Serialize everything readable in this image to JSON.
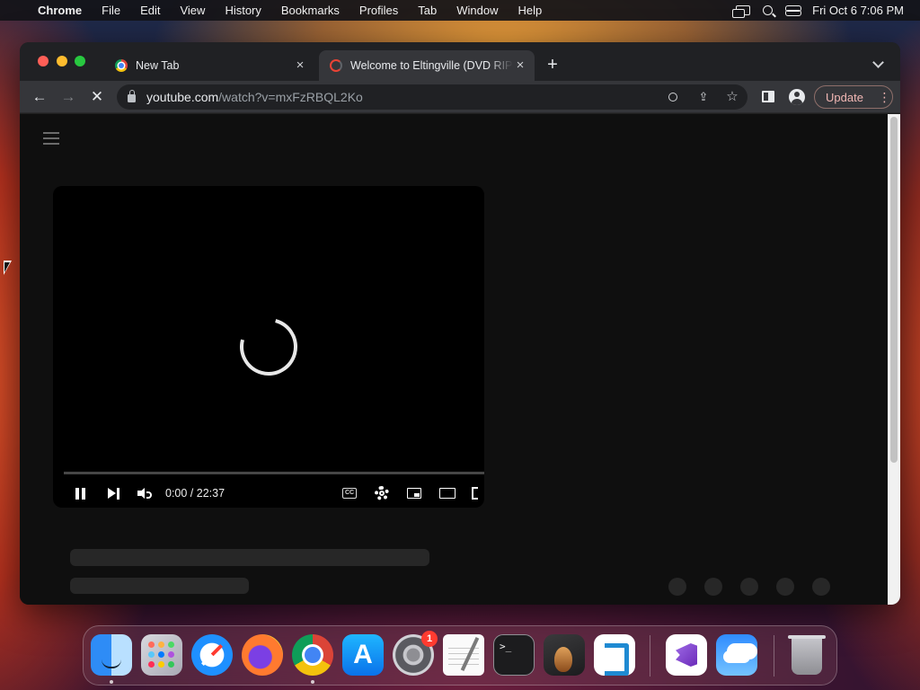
{
  "menubar": {
    "app": "Chrome",
    "items": [
      "File",
      "Edit",
      "View",
      "History",
      "Bookmarks",
      "Profiles",
      "Tab",
      "Window",
      "Help"
    ],
    "clock": "Fri Oct 6  7:06 PM"
  },
  "browser": {
    "tabs": [
      {
        "title": "New Tab",
        "close": "×"
      },
      {
        "title": "Welcome to Eltingville (DVD RIP)",
        "close": "×"
      }
    ],
    "new_tab": "+",
    "back": "←",
    "forward": "→",
    "reload": "✕",
    "url_host": "youtube.com",
    "url_path": "/watch?v=mxFzRBQL2Ko",
    "share": "⇪",
    "bookmark": "☆",
    "update_label": "Update",
    "menu_dots": "⋮"
  },
  "player": {
    "time": "0:00 / 22:37",
    "cc": "CC"
  },
  "dock": {
    "apps": [
      "finder",
      "launchpad",
      "safari",
      "firefox",
      "chrome",
      "app-store",
      "system-settings",
      "textedit",
      "terminal",
      "garageband",
      "vscode",
      "visual-studio",
      "weather",
      "trash"
    ],
    "settings_badge": "1",
    "appstore_glyph": "A",
    "terminal_glyph": ">_"
  },
  "colors": {
    "update_accent": "#f2b8b5",
    "page_bg": "#0f0f0f",
    "skeleton": "#272727"
  }
}
